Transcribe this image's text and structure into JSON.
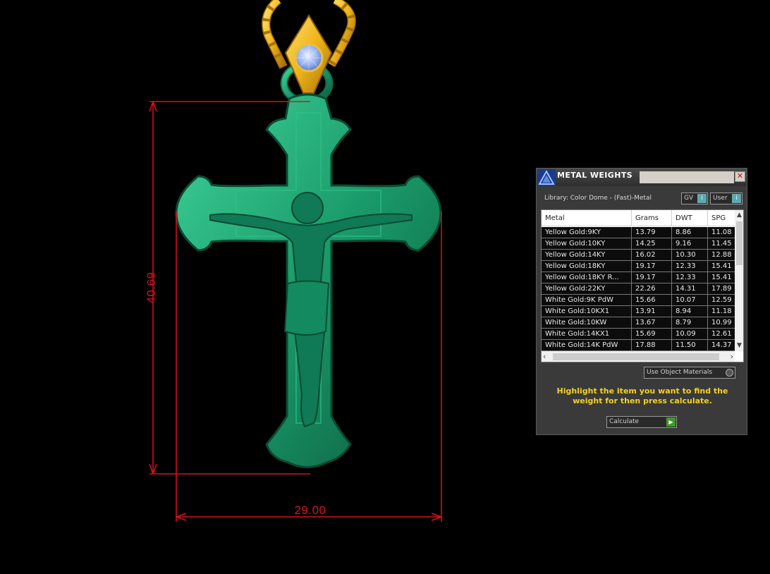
{
  "dimensions": {
    "height_label": "40.69",
    "width_label": "29.00"
  },
  "colors": {
    "background": "#000000",
    "cross_green": "#1e9a6e",
    "chain_gold": "#f0b820",
    "gem_blue": "#9fb8f5",
    "dimension_red": "#d8121f",
    "instruction_yellow": "#f3d21e"
  },
  "panel": {
    "title": "METAL WEIGHTS",
    "close_icon": "close-icon",
    "library_label": "Library: Color Dome - (Fast)-Metal",
    "gv_button": "GV",
    "user_button": "User",
    "columns": [
      "Metal",
      "Grams",
      "DWT",
      "SPG"
    ],
    "rows": [
      {
        "metal": "Yellow Gold:9KY",
        "grams": "13.79",
        "dwt": "8.86",
        "spg": "11.08"
      },
      {
        "metal": "Yellow Gold:10KY",
        "grams": "14.25",
        "dwt": "9.16",
        "spg": "11.45"
      },
      {
        "metal": "Yellow Gold:14KY",
        "grams": "16.02",
        "dwt": "10.30",
        "spg": "12.88"
      },
      {
        "metal": "Yellow Gold:18KY",
        "grams": "19.17",
        "dwt": "12.33",
        "spg": "15.41"
      },
      {
        "metal": "Yellow Gold:18KY R...",
        "grams": "19.17",
        "dwt": "12.33",
        "spg": "15.41"
      },
      {
        "metal": "Yellow Gold:22KY",
        "grams": "22.26",
        "dwt": "14.31",
        "spg": "17.89"
      },
      {
        "metal": "White Gold:9K PdW",
        "grams": "15.66",
        "dwt": "10.07",
        "spg": "12.59"
      },
      {
        "metal": "White Gold:10KX1",
        "grams": "13.91",
        "dwt": "8.94",
        "spg": "11.18"
      },
      {
        "metal": "White Gold:10KW",
        "grams": "13.67",
        "dwt": "8.79",
        "spg": "10.99"
      },
      {
        "metal": "White Gold:14KX1",
        "grams": "15.69",
        "dwt": "10.09",
        "spg": "12.61"
      },
      {
        "metal": "White Gold:14K PdW",
        "grams": "17.88",
        "dwt": "11.50",
        "spg": "14.37"
      }
    ],
    "use_materials_label": "Use Object Materials",
    "instruction": "Highlight the item you want to find the weight for then press calculate.",
    "calculate_label": "Calculate"
  }
}
